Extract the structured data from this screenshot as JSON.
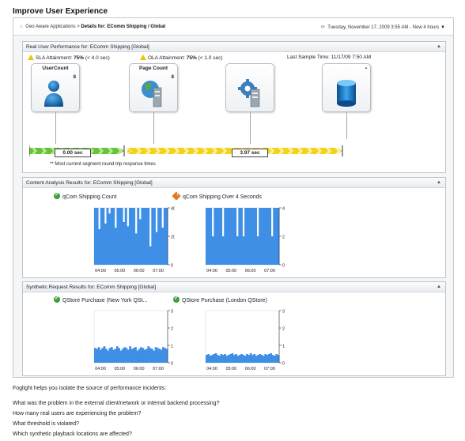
{
  "page_title": "Improve User Experience",
  "breadcrumb": {
    "root": "Geo Aware Applications",
    "sep": ">",
    "current": "Details for: EComm Shipping / Global"
  },
  "timebar": {
    "date": "Tuesday, November 17, 2009 3:55 AM - Now",
    "range": "4 hours",
    "arrow": "▼"
  },
  "panel_rum": {
    "title": "Real User Performance for: EComm Shipping [Global]",
    "collapse": "▲",
    "sla": "SLA Attainment: ",
    "sla_value": "75%",
    "sla_note": " (< 4.0 sec)",
    "ola": "OLA Attainment: ",
    "ola_value": "75%",
    "ola_note": " (< 1.0 sec)",
    "last_sample": "Last Sample Time: 11/17/09 7:50 AM",
    "cards": [
      {
        "label": "UserCount",
        "count": "8",
        "icon": "user-icon"
      },
      {
        "label": "Page Count",
        "count": "8",
        "icon": "globe-server-icon"
      },
      {
        "label": "",
        "count": "",
        "icon": "gear-server-icon"
      },
      {
        "label": "",
        "count": "",
        "icon": "database-icon",
        "more": "▪"
      }
    ],
    "time_network": "0.00 sec",
    "time_backend": "3.97 sec",
    "note": "** Most current segment round trip response times"
  },
  "panel_content": {
    "title": "Content Analysis Results for: EComm Shipping [Global]",
    "collapse": "▲",
    "charts": [
      {
        "title": "qCom Shipping Count",
        "status": "ok"
      },
      {
        "title": "qCom Shipping Over 4 Seconds",
        "status": "critical"
      }
    ]
  },
  "panel_synthetic": {
    "title": "Synthetic Request Results for: EComm Shipping [Global]",
    "collapse": "▲",
    "charts": [
      {
        "title": "QStore Purchase (New York QSt...",
        "status": "ok"
      },
      {
        "title": "QStore Purchase (London QStore)",
        "status": "ok"
      }
    ]
  },
  "chart_data": [
    {
      "type": "area",
      "title": "qCom Shipping Count",
      "x": [
        "04:00",
        "05:00",
        "06:00",
        "07:00"
      ],
      "ylabel": "count",
      "ylim": [
        0,
        40
      ],
      "yticks": [
        0,
        20,
        40
      ],
      "color": "#3f8fe6",
      "values": [
        40,
        40,
        25,
        40,
        40,
        29,
        40,
        36,
        40,
        40,
        26,
        40,
        40,
        40,
        30,
        40,
        27,
        40,
        40,
        40,
        22,
        40,
        32,
        40,
        40,
        40,
        40,
        13,
        40,
        40,
        23,
        40,
        40,
        26,
        40,
        40
      ]
    },
    {
      "type": "area",
      "title": "qCom Shipping Over 4 Seconds",
      "x": [
        "04:00",
        "05:00",
        "06:00",
        "07:00"
      ],
      "ylabel": "count",
      "ylim": [
        0,
        4
      ],
      "yticks": [
        0,
        2,
        4
      ],
      "color": "#3f8fe6",
      "values": [
        4,
        4,
        4,
        2,
        4,
        4,
        4,
        4,
        2,
        4,
        4,
        4,
        4,
        4,
        4,
        2,
        4,
        4,
        2,
        4,
        4,
        4,
        4,
        4,
        4,
        2,
        4,
        4,
        4,
        4,
        4,
        4,
        2,
        4,
        4,
        4
      ]
    },
    {
      "type": "area",
      "title": "QStore Purchase (New York QSt...",
      "x": [
        "04:00",
        "05:00",
        "06:00",
        "07:00"
      ],
      "ylabel": "sec",
      "ylim": [
        0,
        3
      ],
      "yticks": [
        0,
        1,
        2,
        3
      ],
      "color": "#3f8fe6",
      "values": [
        0.85,
        0.8,
        0.9,
        0.75,
        0.85,
        0.95,
        0.8,
        0.7,
        0.85,
        0.9,
        0.75,
        0.8,
        0.95,
        0.85,
        0.7,
        0.8,
        0.9,
        0.85,
        0.75,
        0.95,
        0.8,
        0.85,
        0.9,
        0.7,
        0.8,
        0.9,
        0.85,
        0.75,
        0.8,
        0.95,
        0.85,
        0.8,
        0.7,
        0.9,
        0.85,
        0.8,
        0.75,
        0.9,
        0.85,
        0.8
      ]
    },
    {
      "type": "area",
      "title": "QStore Purchase (London QStore)",
      "x": [
        "04:00",
        "05:00",
        "06:00",
        "07:00"
      ],
      "ylabel": "sec",
      "ylim": [
        0,
        3
      ],
      "yticks": [
        0,
        1,
        2,
        3
      ],
      "color": "#3f8fe6",
      "values": [
        0.45,
        0.5,
        0.4,
        0.45,
        0.5,
        0.55,
        0.45,
        0.4,
        0.5,
        0.45,
        0.5,
        0.4,
        0.45,
        0.5,
        0.55,
        0.45,
        0.5,
        0.4,
        0.45,
        0.5,
        0.45,
        0.4,
        0.5,
        0.45,
        0.55,
        0.45,
        0.5,
        0.4,
        0.45,
        0.5,
        0.45,
        0.4,
        0.5,
        0.45,
        0.5,
        0.55,
        0.45,
        0.4,
        0.5,
        0.45
      ]
    }
  ],
  "footer": {
    "intro": "Foglight helps you isolate the source of performance incidents:",
    "questions": [
      "What was the problem in the external client/network or internal backend processing?",
      "How many real users are experiencing the problem?",
      "What threshold is violated?",
      "Which synthetic playback locations are affected?"
    ]
  }
}
